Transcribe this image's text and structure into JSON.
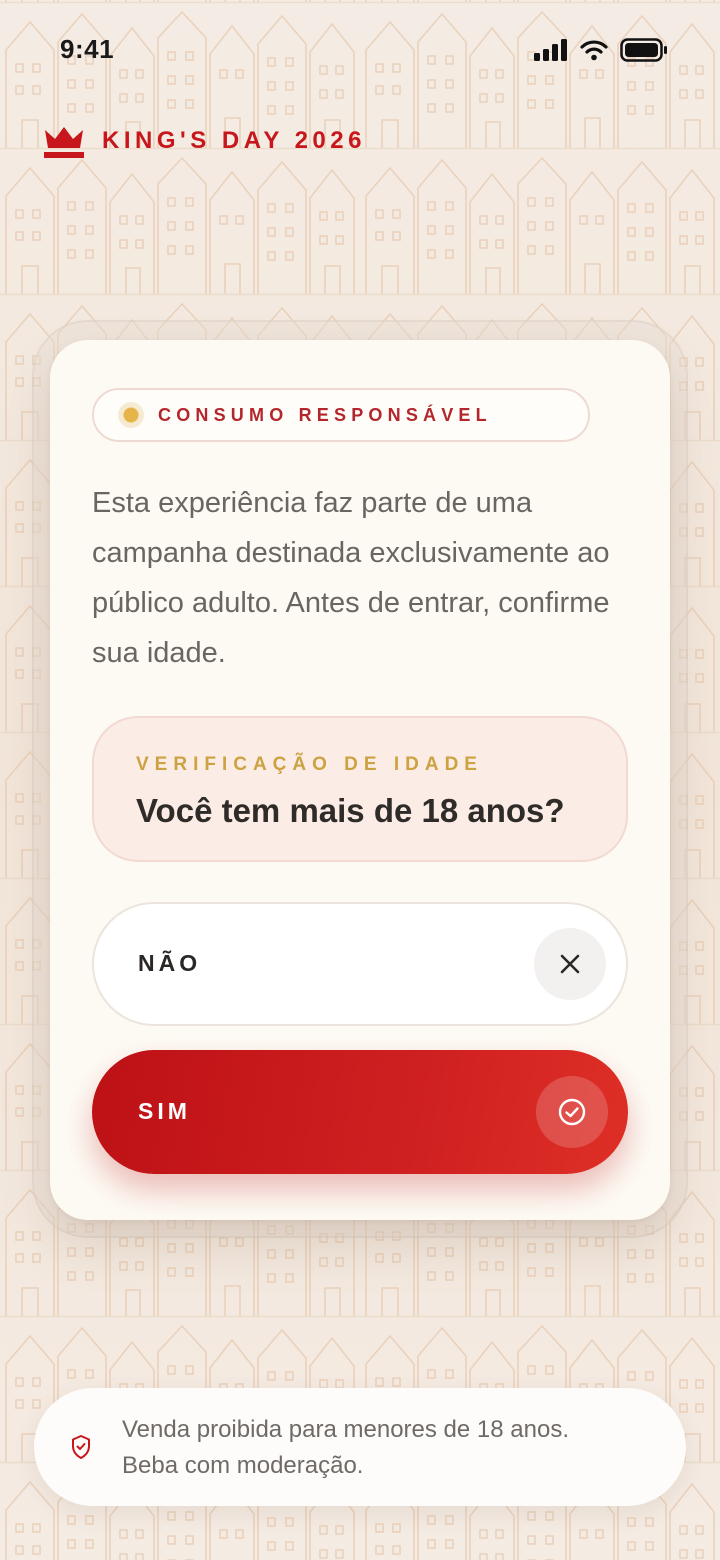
{
  "status_bar": {
    "time": "9:41",
    "icons": [
      "signal-icon",
      "wifi-icon",
      "battery-icon"
    ]
  },
  "brand": {
    "icon": "crown-icon",
    "name": "KING'S DAY 2026"
  },
  "card": {
    "pill_label": "CONSUMO RESPONSÁVEL",
    "intro": "Esta experiência faz parte de uma campanha destinada exclusivamente ao público adulto. Antes de entrar, confirme sua idade.",
    "verification": {
      "eyebrow": "VERIFICAÇÃO DE IDADE",
      "question": "Você tem mais de 18 anos?"
    },
    "buttons": {
      "no_label": "NÃO",
      "no_icon": "close-icon",
      "yes_label": "SIM",
      "yes_icon": "check-circle-icon"
    }
  },
  "footer": {
    "icon": "shield-heart-icon",
    "line1": "Venda proibida para menores de 18 anos.",
    "line2": "Beba com moderação."
  },
  "colors": {
    "brand_red": "#c8161d",
    "accent_gold": "#cda241",
    "background": "#f3e8de",
    "card": "#fdfaf4"
  }
}
